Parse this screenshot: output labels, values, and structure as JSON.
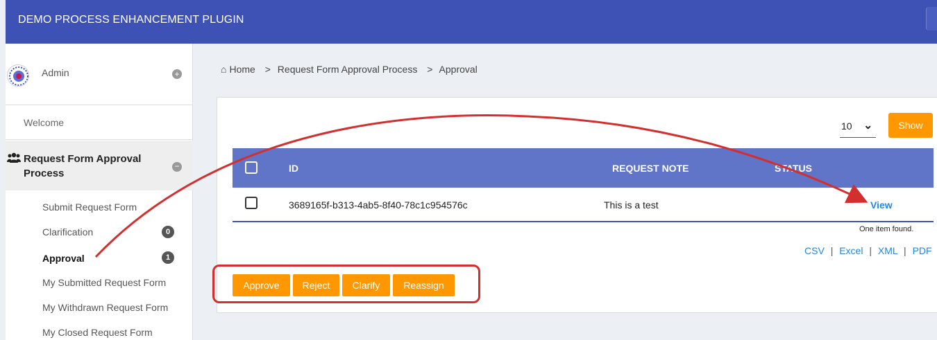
{
  "app": {
    "title": "DEMO PROCESS ENHANCEMENT PLUGIN"
  },
  "sidebar": {
    "user": "Admin",
    "welcome": "Welcome",
    "process": "Request Form Approval Process",
    "items": [
      {
        "label": "Submit Request Form"
      },
      {
        "label": "Clarification",
        "badge": "0"
      },
      {
        "label": "Approval",
        "badge": "1"
      },
      {
        "label": "My Submitted Request Form"
      },
      {
        "label": "My Withdrawn Request Form"
      },
      {
        "label": "My Closed Request Form"
      }
    ]
  },
  "breadcrumb": [
    "Home",
    ">",
    "Request Form Approval Process",
    ">",
    "Approval"
  ],
  "list": {
    "page_size": "10",
    "show_label": "Show",
    "columns": [
      "ID",
      "REQUEST NOTE",
      "STATUS"
    ],
    "rows": [
      {
        "id": "3689165f-b313-4ab5-8f40-78c1c954576c",
        "note": "This is a test",
        "action": "View"
      }
    ],
    "count_text": "One item found.",
    "exports": [
      "CSV",
      "|",
      "Excel",
      "|",
      "XML",
      "|",
      "PDF"
    ]
  },
  "actions": [
    "Approve",
    "Reject",
    "Clarify",
    "Reassign"
  ],
  "colors": {
    "header": "#3e51b5",
    "table_header": "#6074c8",
    "accent": "#ff9800",
    "link": "#1e88e5",
    "annotation": "#d32f2f"
  }
}
